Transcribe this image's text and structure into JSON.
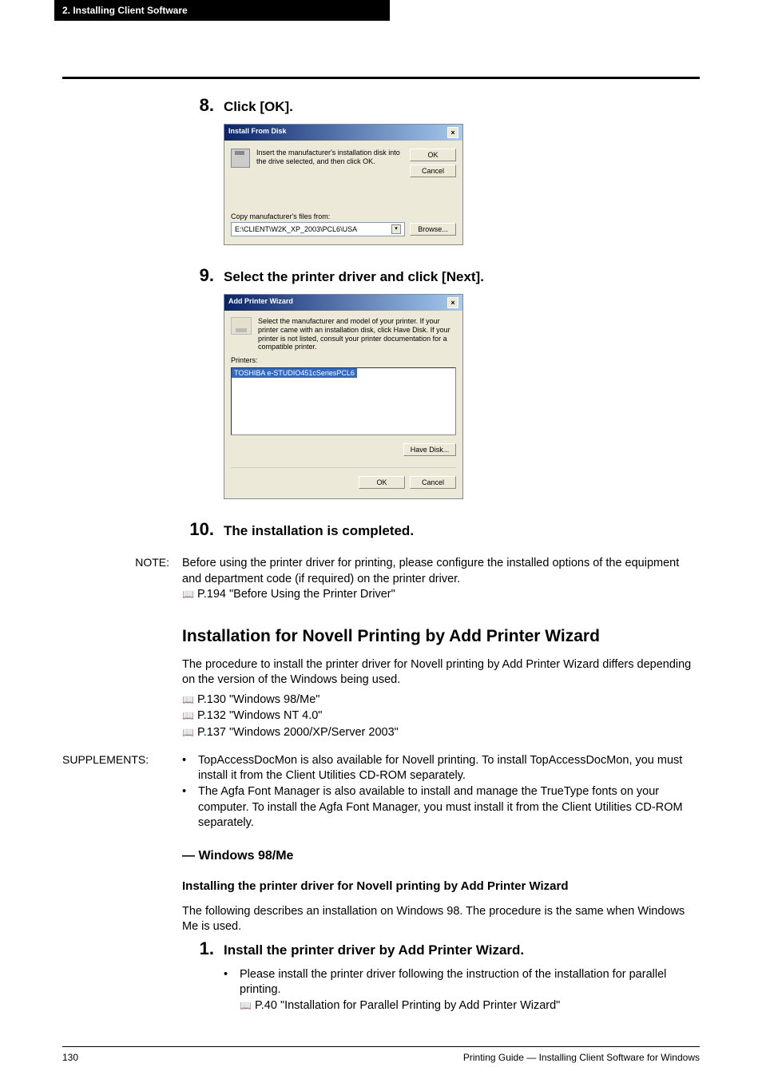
{
  "header": {
    "section": "2. Installing Client Software"
  },
  "steps": {
    "s8": {
      "num": "8.",
      "text": "Click [OK]."
    },
    "s9": {
      "num": "9.",
      "text": "Select the printer driver and click [Next]."
    },
    "s10": {
      "num": "10.",
      "text": "The installation is completed."
    },
    "s1b": {
      "num": "1.",
      "text": "Install the printer driver by Add Printer Wizard."
    }
  },
  "dialog1": {
    "title": "Install From Disk",
    "msg": "Insert the manufacturer's installation disk into the drive selected, and then click OK.",
    "ok": "OK",
    "cancel": "Cancel",
    "copy_label": "Copy manufacturer's files from:",
    "path": "E:\\CLIENT\\W2K_XP_2003\\PCL6\\USA",
    "browse": "Browse..."
  },
  "dialog2": {
    "title": "Add Printer Wizard",
    "msg": "Select the manufacturer and model of your printer. If your printer came with an installation disk, click Have Disk. If your printer is not listed, consult your printer documentation for a compatible printer.",
    "printers_label": "Printers:",
    "selected": "TOSHIBA e-STUDIO451cSeriesPCL6",
    "have_disk": "Have Disk...",
    "ok": "OK",
    "cancel": "Cancel"
  },
  "note": {
    "label": "NOTE:",
    "text": "Before using the printer driver for printing, please configure the installed options of the equipment and department code (if required) on the printer driver.",
    "link": "P.194 \"Before Using the Printer Driver\""
  },
  "section": {
    "title": "Installation for Novell Printing by Add Printer Wizard",
    "para": "The procedure to install the printer driver for Novell printing by Add Printer Wizard differs depending on the version of the Windows being used.",
    "link1": "P.130 \"Windows 98/Me\"",
    "link2": "P.132 \"Windows NT 4.0\"",
    "link3": "P.137 \"Windows 2000/XP/Server 2003\""
  },
  "supp": {
    "label": "SUPPLEMENTS:",
    "b1": "TopAccessDocMon is also available for Novell printing.  To install TopAccessDocMon, you must install it from the Client Utilities CD-ROM separately.",
    "b2": "The Agfa Font Manager is also available to install and manage the TrueType fonts on your computer.  To install the Agfa Font Manager, you must install it from the Client Utilities CD-ROM separately."
  },
  "sub": {
    "h3": "— Windows 98/Me",
    "h4": "Installing the printer driver for Novell printing by Add Printer Wizard",
    "para": "The following describes an installation on Windows 98.  The procedure is the same when Windows Me is used.",
    "b1": "Please install the printer driver following the instruction of the installation for parallel printing.",
    "link": "P.40 \"Installation for Parallel Printing by Add Printer Wizard\""
  },
  "footer": {
    "page": "130",
    "right": "Printing Guide — Installing Client Software for Windows"
  }
}
